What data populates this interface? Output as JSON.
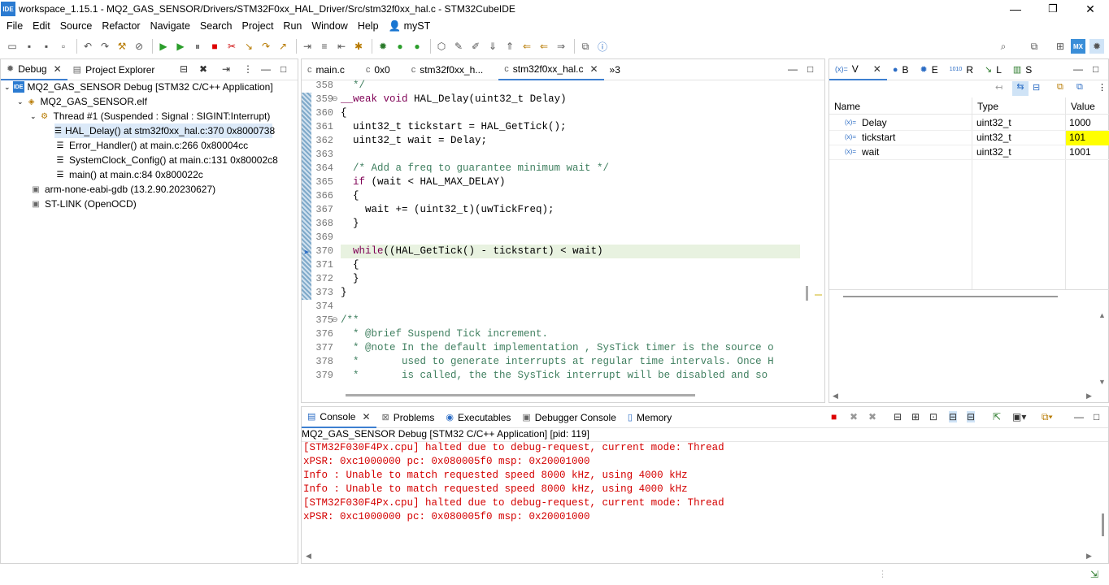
{
  "window": {
    "title": "workspace_1.15.1 - MQ2_GAS_SENSOR/Drivers/STM32F0xx_HAL_Driver/Src/stm32f0xx_hal.c - STM32CubeIDE",
    "app_badge": "IDE",
    "minimize": "—",
    "restore": "❐",
    "close": "✕"
  },
  "menu": [
    "File",
    "Edit",
    "Source",
    "Refactor",
    "Navigate",
    "Search",
    "Project",
    "Run",
    "Window",
    "Help",
    "myST"
  ],
  "debug_view": {
    "tabs": [
      {
        "label": "Debug",
        "close": "✕"
      },
      {
        "label": "Project Explorer"
      }
    ],
    "tree": [
      {
        "label": "MQ2_GAS_SENSOR Debug [STM32 C/C++ Application]",
        "icon": "IDE"
      },
      {
        "label": "MQ2_GAS_SENSOR.elf",
        "icon": "elf-icon"
      },
      {
        "label": "Thread #1 (Suspended : Signal : SIGINT:Interrupt)",
        "icon": "thread-icon"
      },
      {
        "label": "HAL_Delay() at stm32f0xx_hal.c:370 0x8000738",
        "icon": "stack-frame-icon"
      },
      {
        "label": "Error_Handler() at main.c:266 0x80004cc",
        "icon": "stack-frame-icon"
      },
      {
        "label": "SystemClock_Config() at main.c:131 0x80002c8",
        "icon": "stack-frame-icon"
      },
      {
        "label": "main() at main.c:84 0x800022c",
        "icon": "stack-frame-icon"
      },
      {
        "label": "arm-none-eabi-gdb (13.2.90.20230627)",
        "icon": "process-icon"
      },
      {
        "label": "ST-LINK (OpenOCD)",
        "icon": "process-icon"
      }
    ]
  },
  "editor": {
    "tabs": [
      {
        "label": "main.c",
        "icon": "c"
      },
      {
        "label": "0x0",
        "icon": "c"
      },
      {
        "label": "stm32f0xx_h...",
        "icon": "c"
      },
      {
        "label": "stm32f0xx_hal.c",
        "icon": "c",
        "close": "✕"
      },
      {
        "label": "»3"
      }
    ],
    "lines": [
      {
        "n": "358",
        "text": "  */"
      },
      {
        "n": "359",
        "text": "__weak void HAL_Delay(uint32_t Delay)"
      },
      {
        "n": "360",
        "text": "{"
      },
      {
        "n": "361",
        "text": "  uint32_t tickstart = HAL_GetTick();"
      },
      {
        "n": "362",
        "text": "  uint32_t wait = Delay;"
      },
      {
        "n": "363",
        "text": ""
      },
      {
        "n": "364",
        "text": "  /* Add a freq to guarantee minimum wait */"
      },
      {
        "n": "365",
        "text": "  if (wait < HAL_MAX_DELAY)"
      },
      {
        "n": "366",
        "text": "  {"
      },
      {
        "n": "367",
        "text": "    wait += (uint32_t)(uwTickFreq);"
      },
      {
        "n": "368",
        "text": "  }"
      },
      {
        "n": "369",
        "text": ""
      },
      {
        "n": "370",
        "text": "  while((HAL_GetTick() - tickstart) < wait)"
      },
      {
        "n": "371",
        "text": "  {"
      },
      {
        "n": "372",
        "text": "  }"
      },
      {
        "n": "373",
        "text": "}"
      },
      {
        "n": "374",
        "text": ""
      },
      {
        "n": "375",
        "text": "/**"
      },
      {
        "n": "376",
        "text": "  * @brief Suspend Tick increment."
      },
      {
        "n": "377",
        "text": "  * @note In the default implementation , SysTick timer is the source o"
      },
      {
        "n": "378",
        "text": "  *       used to generate interrupts at regular time intervals. Once H"
      },
      {
        "n": "379",
        "text": "  *       is called, the the SysTick interrupt will be disabled and so"
      }
    ]
  },
  "variables_view": {
    "tabs": [
      {
        "label": "V",
        "prefix": "(x)=",
        "close": "✕"
      },
      {
        "label": "B"
      },
      {
        "label": "E"
      },
      {
        "label": "R",
        "prefix": "1010"
      },
      {
        "label": "L"
      },
      {
        "label": "S"
      }
    ],
    "columns": [
      "Name",
      "Type",
      "Value"
    ],
    "rows": [
      {
        "name": "Delay",
        "type": "uint32_t",
        "value": "1000"
      },
      {
        "name": "tickstart",
        "type": "uint32_t",
        "value": "101"
      },
      {
        "name": "wait",
        "type": "uint32_t",
        "value": "1001"
      }
    ],
    "changed_value_color": "#ffff00"
  },
  "console": {
    "tabs": [
      {
        "label": "Console",
        "close": "✕"
      },
      {
        "label": "Problems"
      },
      {
        "label": "Executables"
      },
      {
        "label": "Debugger Console"
      },
      {
        "label": "Memory"
      }
    ],
    "header": "MQ2_GAS_SENSOR Debug [STM32 C/C++ Application]  [pid: 119]",
    "lines": [
      "[STM32F030F4Px.cpu] halted due to debug-request, current mode: Thread",
      "xPSR: 0xc1000000 pc: 0x080005f0 msp: 0x20001000",
      "Info : Unable to match requested speed 8000 kHz, using 4000 kHz",
      "Info : Unable to match requested speed 8000 kHz, using 4000 kHz",
      "[STM32F030F4Px.cpu] halted due to debug-request, current mode: Thread",
      "xPSR: 0xc1000000 pc: 0x080005f0 msp: 0x20001000"
    ],
    "text_color": "#d40000"
  },
  "colors": {
    "accent": "#3d7fd0",
    "selection": "#dbe9f8",
    "keyword": "#7f0055",
    "comment": "#3f7f5f",
    "current_line": "#e8f2e0"
  }
}
